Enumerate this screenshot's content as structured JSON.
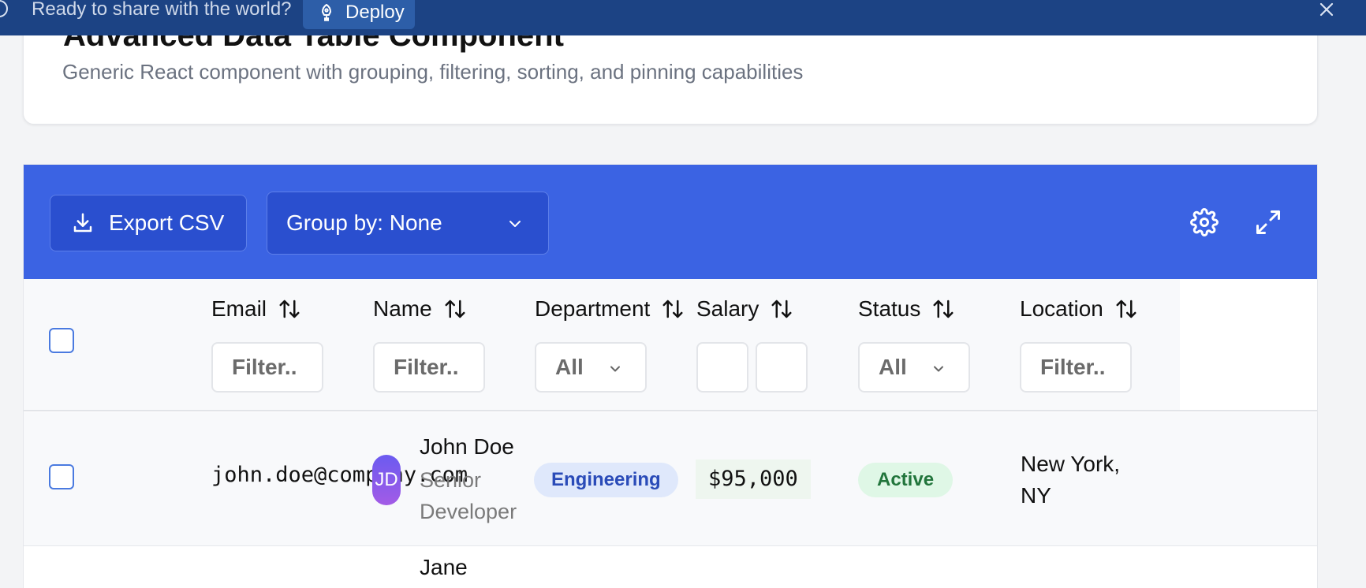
{
  "banner": {
    "message": "Ready to share with the world?",
    "deploy_label": "Deploy"
  },
  "header": {
    "title": "Advanced Data Table Component",
    "subtitle": "Generic React component with grouping, filtering, sorting, and pinning capabilities"
  },
  "toolbar": {
    "export_label": "Export CSV",
    "group_by_label": "Group by: None"
  },
  "columns": [
    {
      "label": "Email",
      "filter_placeholder": "Filter.."
    },
    {
      "label": "Name",
      "filter_placeholder": "Filter.."
    },
    {
      "label": "Department",
      "filter_value": "All"
    },
    {
      "label": "Salary"
    },
    {
      "label": "Status",
      "filter_value": "All"
    },
    {
      "label": "Location",
      "filter_placeholder": "Filter.."
    }
  ],
  "rows": [
    {
      "email": "john.doe@company.com",
      "initials": "JD",
      "name": "John Doe",
      "role": "Senior Developer",
      "department": "Engineering",
      "salary": "$95,000",
      "status": "Active",
      "location": "New York, NY"
    },
    {
      "name": "Jane"
    }
  ],
  "colors": {
    "banner": "#1c4384",
    "toolbar": "#3b63e3",
    "accent": "#2a4fcf",
    "status_active_bg": "#dff7e6",
    "status_active_text": "#22753c",
    "dept_bg": "#dfe8fb"
  }
}
